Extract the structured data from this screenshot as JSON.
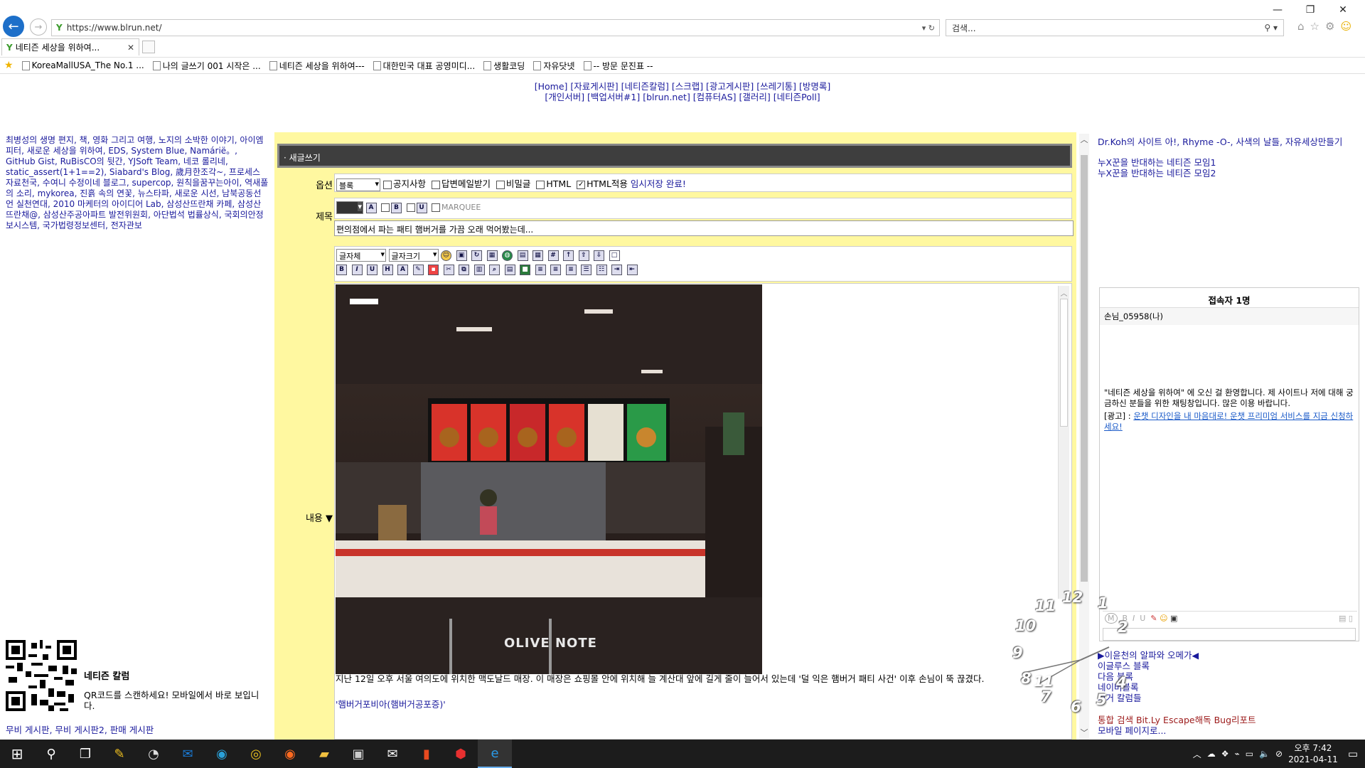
{
  "browser": {
    "url": "https://www.blrun.net/",
    "search_placeholder": "검색...",
    "tab_title": "네티즌 세상을 위하여...",
    "favorites": [
      "KoreaMallUSA_The No.1 ...",
      "나의 글쓰기 001 시작은 ...",
      "네티즌 세상을 위하여---",
      "대한민국 대표 공영미디...",
      "생활코딩",
      "자유닷넷",
      "-- 방문 문진표 --"
    ]
  },
  "topnav": {
    "line1": "[Home] [자료게시판] [네티즌칼럼] [스크랩] [광고게시판] [쓰레기통] [방명록]",
    "line2": "[개인서버] [백업서버#1] [blrun.net] [컴퓨터AS] [갤러리] [네티즌Poll]"
  },
  "left": {
    "links": "최병성의 생명 편지, 책, 영화 그리고 여행, 노지의 소박한 이야기, 아이엠피터, 새로운 세상을 위하여, EDS, System Blue, Namárië。, GitHub Gist, RuBisCO의 뒷간, YJSoft Team, 네코 롤리네, static_assert(1+1==2), Siabard's Blog, 歲月한조각~, 프로세스 자료천국, 수여니 수정이네 블로그, supercop, 원칙을꿈꾸는아이, 역새풀의 소리, mykorea, 진흙 속의 연꽃, 뉴스타파, 새로운 시선, 남북공동선언 실천연대, 2010 마케터의 아이디어 Lab, 삼성산뜨란채 카페, 삼성산뜨란채@, 삼성산주공아파트 발전위원회, 아단법석 법률상식, 국회의안정보시스템, 국가법령정보센터, 전자관보",
    "qr_title": "네티즌 칼럼",
    "qr_text": "QR코드를 스캔하세요! 모바일에서 바로 보입니다.",
    "boards": "무비 게시판, 무비 게시판2, 판매 게시판"
  },
  "write": {
    "header": "· 새글쓰기",
    "label_options": "옵션",
    "label_title": "제목",
    "label_content": "내용 ▼",
    "option_select": "블록",
    "checks": [
      {
        "label": "공지사항",
        "checked": false
      },
      {
        "label": "답변메일받기",
        "checked": false
      },
      {
        "label": "비밀글",
        "checked": false
      },
      {
        "label": "HTML",
        "checked": false
      },
      {
        "label": "HTML적용",
        "checked": true
      }
    ],
    "temp_save": "임시저장 완료!",
    "marquee": "MARQUEE",
    "title_value": "편의점에서 파는 패티 햄버거를 가끔 오래 먹어봤는데...",
    "font_select": "글자체",
    "size_select": "글자크기",
    "photo_watermark": "OLIVE NOTE",
    "body_text": "지난 12일 오후 서울 여의도에 위치한 맥도날드 매장. 이 매장은 쇼핑몰 안에 위치해 늘 계산대 앞에 길게 줄이 늘어서 있는데  '덜 익은 햄버거 패티 사건' 이후 손님이 뚝 끊겼다.",
    "body_quote": "'햄버거포비아(햄버거공포증)'"
  },
  "right": {
    "links1": "Dr.Koh의 사이트 아!, Rhyme -O-, 사색의 날들, 자유세상만들기",
    "links2": "누X꾼을 반대하는 네티즌 모임1",
    "links3": "누X꾼을 반대하는 네티즌 모임2",
    "chat_title": "접속자 1명",
    "chat_user": "손님_05958(나)",
    "chat_welcome": "\"네티즌 세상을 위하여\" 에 오신 걸 환영합니다. 제 사이트나 저에 대해 궁금하신 분들을 위한 채팅창입니다. 많은 이용 바랍니다.",
    "chat_ad_label": "[광고] :",
    "chat_ad": "운챗 디자인을 내 마음대로! 운챗 프리미엄 서비스를 지금 신청하세요!",
    "bottom_links": [
      "▶이윤천의 알파와 오메가◀",
      "이글루스 블록",
      "다음 블록",
      "네이버블록",
      "겨거 칼럼들"
    ],
    "bottom_red": "통합 검색 Bit.Ly Escape해독 Bug리포트",
    "mobile": "모바일 페이지로..."
  },
  "clock": {
    "numbers": [
      "11",
      "12",
      "1",
      "10",
      "2",
      "9",
      "8",
      "7",
      "6",
      "5",
      "4"
    ]
  },
  "taskbar": {
    "time": "오후 7:42",
    "date": "2021-04-11"
  }
}
